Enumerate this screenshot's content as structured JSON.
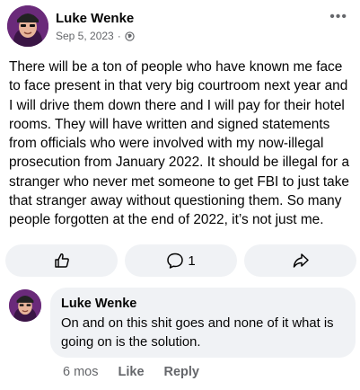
{
  "post": {
    "author": "Luke Wenke",
    "date": "Sep 5, 2023",
    "separator": "·",
    "audience_icon": "globe-icon",
    "more_icon": "more-icon",
    "more_label": "•••",
    "body": "There will be a ton of people who have known me face to face present in that very big courtroom next year and I will drive them down there and I will pay for their hotel rooms.  They will have written and signed statements from officials who were involved with my now-illegal prosecution from January 2022.  It should be illegal for a stranger who never met someone to get FBI to just take that stranger away without questioning them.  So many people forgotten at the end of 2022, it’s not just me."
  },
  "actions": {
    "like_icon": "thumbs-up-icon",
    "comment_icon": "comment-icon",
    "comment_count": "1",
    "share_icon": "share-icon"
  },
  "comment": {
    "author": "Luke Wenke",
    "text": "On and on this shit goes and none of it what is going on is the solution.",
    "time": "6 mos",
    "like_label": "Like",
    "reply_label": "Reply"
  },
  "colors": {
    "text": "#050505",
    "secondary": "#65676b",
    "bubble": "#f0f2f5",
    "avatar_bg": "#6a2a7a"
  }
}
